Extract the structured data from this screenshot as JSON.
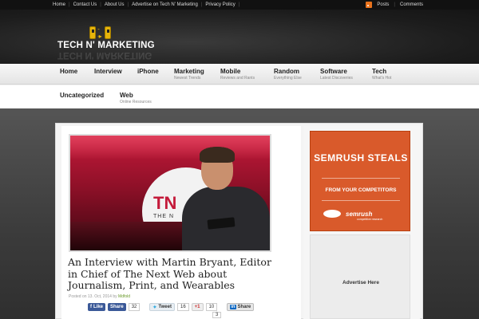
{
  "topbar": {
    "links": [
      "Home",
      "Contact Us",
      "About Us",
      "Advertise on Tech N' Marketing",
      "Privacy Policy"
    ],
    "posts_label": "Posts",
    "comments_label": "Comments"
  },
  "header": {
    "logo_text": "TECH N' MARKETING"
  },
  "nav": {
    "row1": [
      {
        "label": "Home",
        "sub": ""
      },
      {
        "label": "Interview",
        "sub": ""
      },
      {
        "label": "iPhone",
        "sub": ""
      },
      {
        "label": "Marketing",
        "sub": "Newest Trends"
      },
      {
        "label": "Mobile",
        "sub": "Reviews and Rants"
      },
      {
        "label": "Random",
        "sub": "Everything Else"
      },
      {
        "label": "Software",
        "sub": "Latest Discoveries"
      },
      {
        "label": "Tech",
        "sub": "What's Hot"
      }
    ],
    "row2": [
      {
        "label": "Uncategorized",
        "sub": ""
      },
      {
        "label": "Web",
        "sub": "Online Resources"
      }
    ]
  },
  "article": {
    "title": "An Interview with Martin Bryant, Editor in Chief of The Next Web about Journalism, Print, and Wearables",
    "posted_prefix": "Posted on 13. Oct, 2014 by",
    "author": "Mdfold",
    "photo": {
      "logo": "TN",
      "tagline": "THE N"
    }
  },
  "shares": {
    "fb_label": "Like",
    "fb_share": "Share",
    "fb_count": "32",
    "tweet_label": "Tweet",
    "tweet_count": "16",
    "gplus_label": "+1",
    "gplus_count": "10",
    "li_label": "Share",
    "li_count": "3"
  },
  "sidebar": {
    "ad_headline": "SEMRUSH STEALS",
    "ad_sub": "FROM YOUR COMPETITORS",
    "ad_brand": "semrush",
    "ad_brand_sub": "competitive research",
    "advertise_label": "Advertise Here"
  },
  "colors": {
    "accent": "#d95a2b",
    "facebook": "#3b5998",
    "author": "#6a9a2a"
  }
}
